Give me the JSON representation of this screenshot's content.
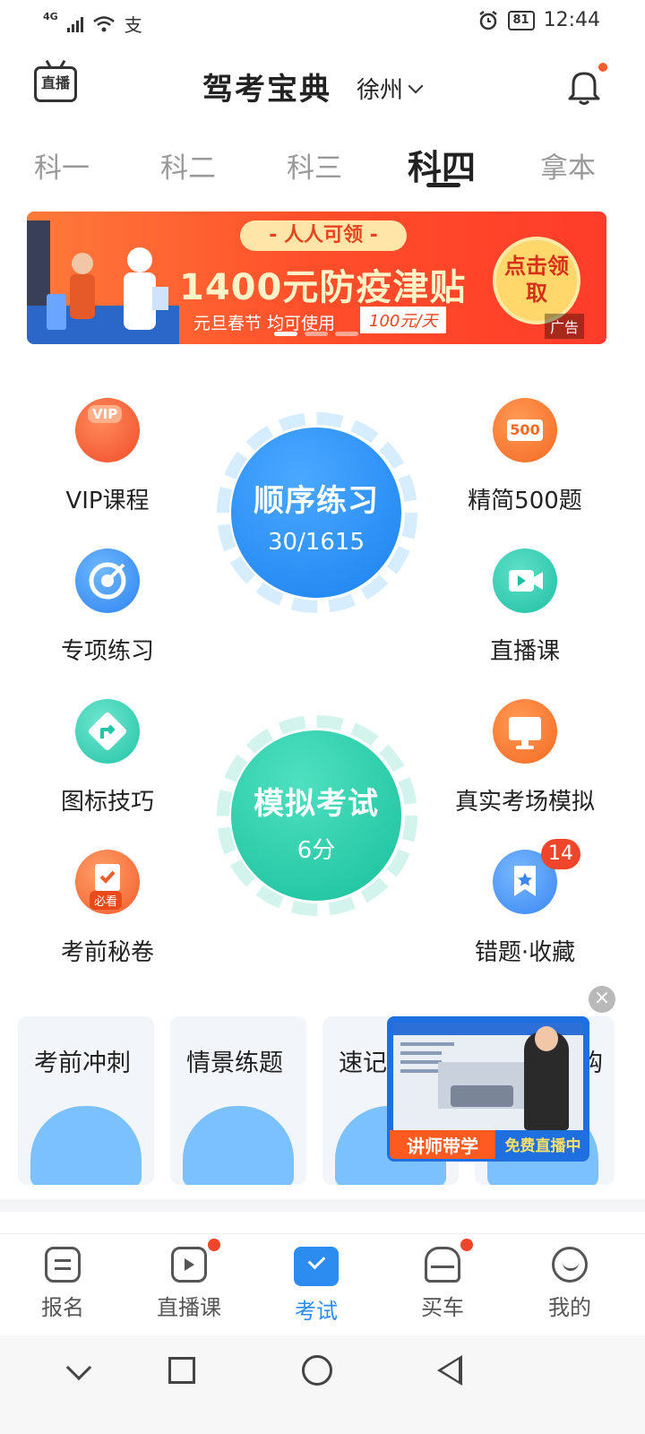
{
  "status_bar": {
    "network": "4G",
    "pay_icon": "支",
    "battery": "81",
    "time": "12:44"
  },
  "header": {
    "live_icon_label": "直播",
    "title": "驾考宝典",
    "city": "徐州"
  },
  "subject_tabs": [
    {
      "label": "科一",
      "active": false
    },
    {
      "label": "科二",
      "active": false
    },
    {
      "label": "科三",
      "active": false
    },
    {
      "label": "科四",
      "active": true
    },
    {
      "label": "拿本",
      "active": false
    }
  ],
  "banner": {
    "pill": "- 人人可领 -",
    "headline": "1400元防疫津贴",
    "subtitle": "元旦春节  均可使用",
    "subtitle_tag": "100元/天",
    "claim_button": "点击领取",
    "ad_tag": "广告"
  },
  "practice": {
    "sequential": {
      "title": "顺序练习",
      "progress": "30/1615"
    },
    "mock_exam": {
      "title": "模拟考试",
      "score": "6分"
    }
  },
  "grid": {
    "vip": {
      "label": "VIP课程",
      "icon_text": "VIP"
    },
    "simplified": {
      "label": "精简500题",
      "icon_text": "500"
    },
    "special": {
      "label": "专项练习"
    },
    "live_course": {
      "label": "直播课"
    },
    "signs": {
      "label": "图标技巧"
    },
    "real_exam": {
      "label": "真实考场模拟"
    },
    "secret": {
      "label": "考前秘卷",
      "icon_text": "必看"
    },
    "wrong": {
      "label": "错题·收藏",
      "badge": "14"
    }
  },
  "cards": [
    {
      "label": "考前冲刺"
    },
    {
      "label": "情景练题"
    },
    {
      "label": "速记"
    },
    {
      "label": "购"
    }
  ],
  "promo": {
    "left_label": "讲师带学",
    "right_label": "免费直播中"
  },
  "bottom_nav": [
    {
      "label": "报名",
      "active": false
    },
    {
      "label": "直播课",
      "active": false
    },
    {
      "label": "考试",
      "active": true
    },
    {
      "label": "买车",
      "active": false
    },
    {
      "label": "我的",
      "active": false
    }
  ],
  "colors": {
    "accent_blue": "#2d8cf0",
    "accent_green": "#19c09c",
    "accent_orange": "#f46a22",
    "badge_red": "#f0452a"
  }
}
